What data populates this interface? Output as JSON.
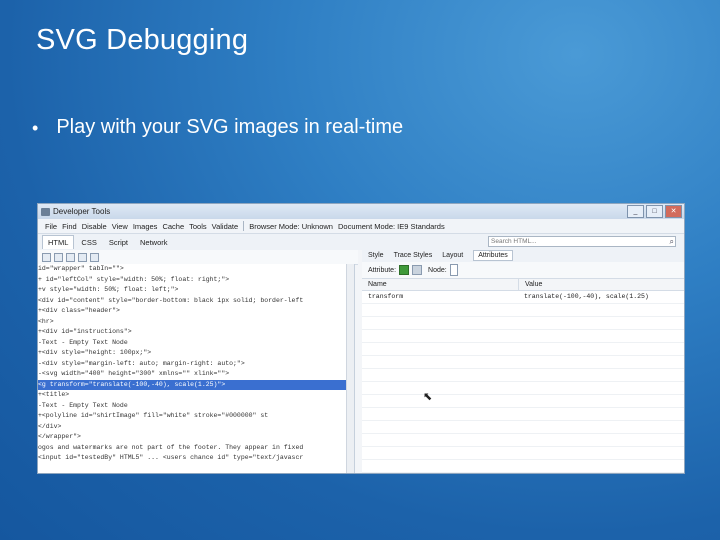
{
  "slide": {
    "title": "SVG Debugging",
    "bullet": "Play with your SVG images in real-time"
  },
  "devtools": {
    "window_title": "Developer Tools",
    "window_buttons": [
      "_",
      "□",
      "✕"
    ],
    "menu": [
      "File",
      "Find",
      "Disable",
      "View",
      "Images",
      "Cache",
      "Tools",
      "Validate",
      "Browser Mode: Unknown",
      "Document Mode: IE9 Standards"
    ],
    "tabs": [
      "HTML",
      "CSS",
      "Script",
      "Network"
    ],
    "search_placeholder": "Search HTML...",
    "code_lines": [
      "id=\"wrapper\" tabIn=\"\">",
      "+ id=\"leftCol\" style=\"width: 50%; float: right;\">",
      "+v style=\"width: 50%; float: left;\">",
      " <div id=\"content\" style=\"border-bottom: black 1px solid; border-left",
      "  +<div class=\"header\">",
      "   <hr>",
      "  +<div id=\"instructions\">",
      "  -Text - Empty Text Node",
      "  +<div style=\"height: 100px;\">",
      "  -<div style=\"margin-left: auto; margin-right: auto;\">",
      "    -<svg width=\"400\" height=\"300\" xmlns=\"\" xlink=\"\">",
      "      <g transform=\"translate(-100,-40), scale(1.25)\">",
      "       +<title>",
      "        -Text - Empty Text Node",
      "       +<polyline id=\"shirtImage\" fill=\"white\" stroke=\"#000000\" st",
      "  </div>",
      "</wrapper\">",
      "ogos and watermarks are not part of the footer. They appear in fixed",
      "<input id=\"testedBy\" HTML5\" ...   <users chance id\" type=\"text/javascr"
    ],
    "right_tabs": [
      "Style",
      "Trace Styles",
      "Layout",
      "Attributes"
    ],
    "attributes_label": "Attribute:",
    "node_label": "Node:",
    "columns": [
      "Name",
      "Value"
    ],
    "attributes": [
      {
        "name": "transform",
        "value": "translate(-100,-40), scale(1.25)"
      }
    ]
  }
}
